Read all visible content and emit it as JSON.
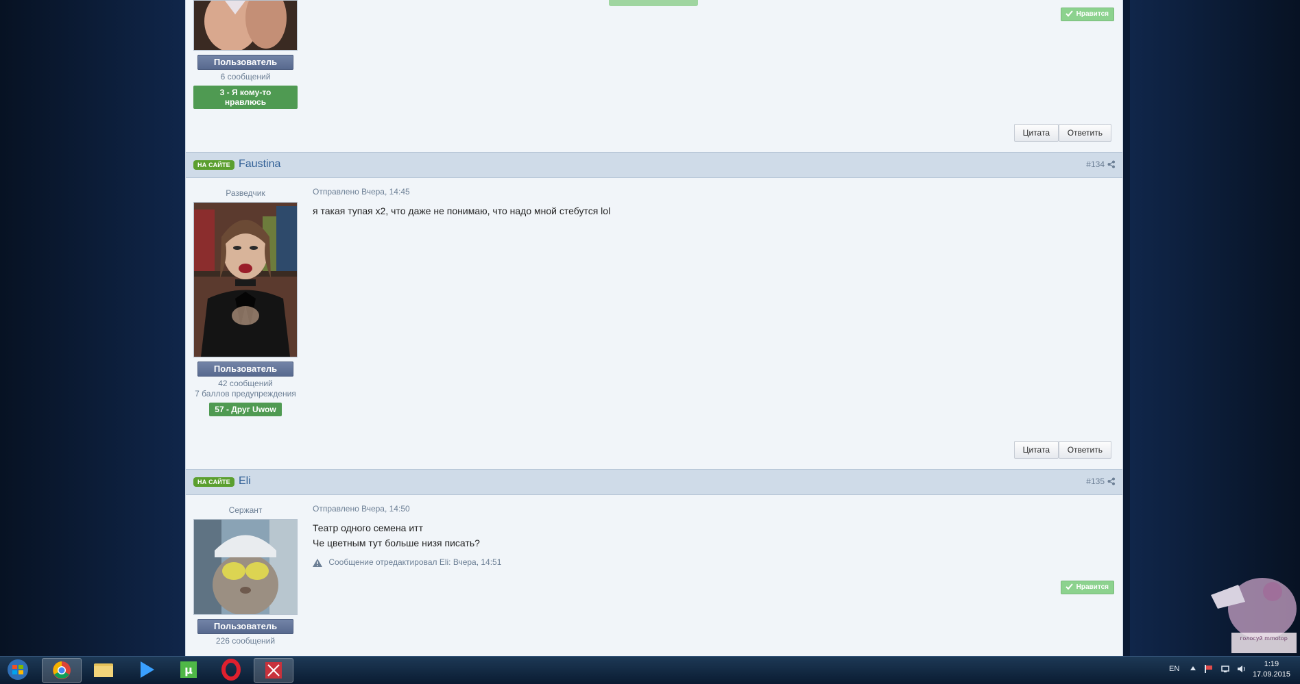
{
  "posts": [
    {
      "rank": "",
      "group": "Пользователь",
      "stats": [
        "6 сообщений"
      ],
      "reputation": "3 - Я кому-то нравлюсь",
      "quote_label": "Цитата",
      "reply_label": "Ответить",
      "like_label": "Нравится"
    },
    {
      "online": "НА САЙТЕ",
      "author": "Faustina",
      "number": "#134",
      "rank": "Разведчик",
      "group": "Пользователь",
      "stats": [
        "42 сообщений",
        "7 баллов предупреждения"
      ],
      "reputation": "57 - Друг Uwow",
      "date": "Отправлено Вчера, 14:45",
      "text": [
        "я такая тупая x2, что даже не понимаю, что надо мной стебутся lol"
      ],
      "quote_label": "Цитата",
      "reply_label": "Ответить"
    },
    {
      "online": "НА САЙТЕ",
      "author": "Eli",
      "number": "#135",
      "rank": "Сержант",
      "group": "Пользователь",
      "stats": [
        "226 сообщений"
      ],
      "date": "Отправлено Вчера, 14:50",
      "text": [
        "Театр одного семена итт",
        "Че цветным тут больше низя писать?"
      ],
      "edit_note": "Сообщение отредактировал Eli: Вчера, 14:51",
      "like_label": "Нравится"
    }
  ],
  "taskbar": {
    "language": "EN",
    "time": "1:19",
    "date": "17.09.2015",
    "apps": [
      "start-orb",
      "chrome",
      "explorer",
      "media-player",
      "utorrent",
      "opera",
      "app-red"
    ]
  },
  "widget": {
    "text": "голосуй mmotop"
  }
}
